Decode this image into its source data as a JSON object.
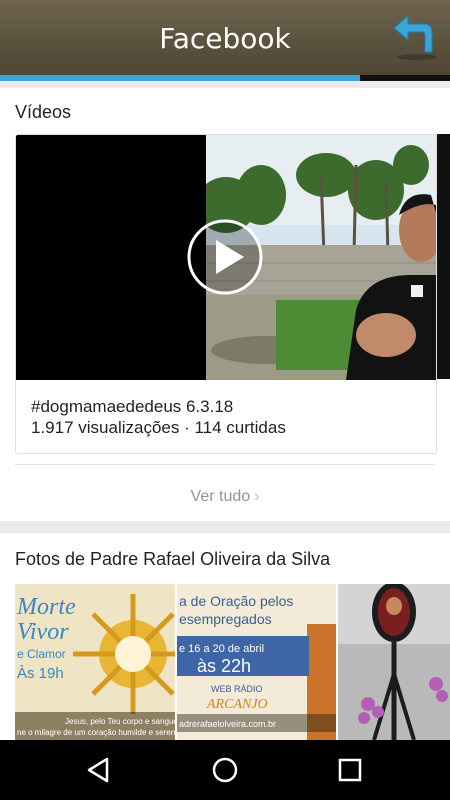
{
  "header": {
    "title": "Facebook",
    "back_icon": "back-arrow-icon",
    "accent": "#3aa6d8"
  },
  "progress": {
    "value": 0.8
  },
  "videos": {
    "title": "Vídeos",
    "items": [
      {
        "caption": "#dogmamaededeus 6.3.18",
        "meta": "1.917 visualizações · 114 curtidas"
      }
    ],
    "see_all": "Ver tudo"
  },
  "photos": {
    "title": "Fotos de Padre Rafael Oliveira da Silva",
    "items": [
      {
        "line1": "Morte",
        "line2": "Vivor",
        "line3": "e Clamor",
        "line4": "Às 19h",
        "line5": "Jesus, pelo Teu corpo e sangue",
        "line6": "ne o milagre de um coração humilde e sereno"
      },
      {
        "line1": "a de Oração pelos",
        "line2": "esempregados",
        "line3": "e 16 a 20 de abril",
        "line4": "às 22h",
        "line5": "WEB RÁDIO",
        "line6": "ARCANJO",
        "line7": "adrerafaelolveira.com.br"
      },
      {
        "alt": ""
      }
    ]
  },
  "navbar": {
    "back": "nav-back-icon",
    "home": "nav-home-icon",
    "recents": "nav-recents-icon"
  }
}
